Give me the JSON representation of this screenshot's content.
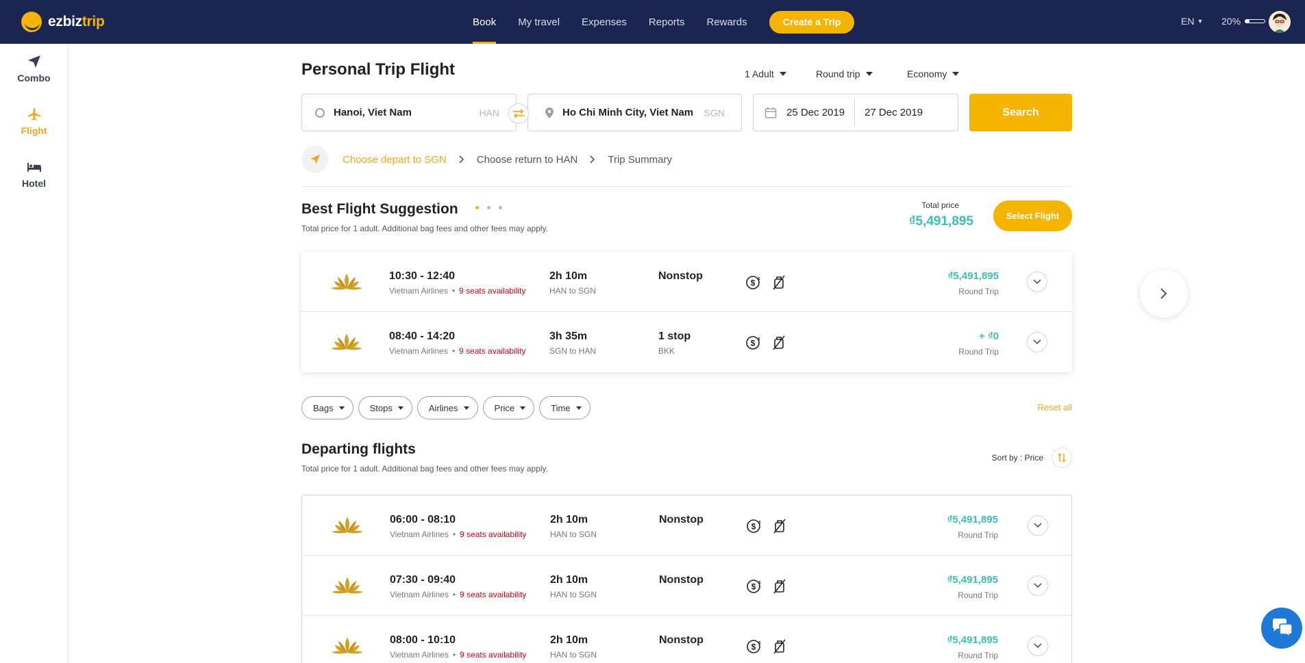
{
  "brand": {
    "name_part1": "ezbiz",
    "name_part2": "trip"
  },
  "nav": {
    "items": [
      "Book",
      "My travel",
      "Expenses",
      "Reports",
      "Rewards"
    ],
    "create_label": "Create a Trip",
    "language": "EN",
    "progress_label": "20%",
    "progress_value": 0.2
  },
  "sidebar": {
    "items": [
      "Combo",
      "Flight",
      "Hotel"
    ]
  },
  "page": {
    "title": "Personal Trip Flight"
  },
  "selectors": {
    "passengers": "1 Adult",
    "trip_type": "Round trip",
    "cabin": "Economy"
  },
  "search": {
    "from": "Hanoi, Viet Nam",
    "from_code": "HAN",
    "to": "Ho Chi Minh City, Viet Nam",
    "to_code": "SGN",
    "depart_date": "25 Dec 2019",
    "return_date": "27 Dec 2019",
    "button": "Search"
  },
  "steps": [
    "Choose depart to SGN",
    "Choose return to HAN",
    "Trip Summary"
  ],
  "best": {
    "title": "Best Flight Suggestion",
    "subtitle": "Total price for 1 adult. Additional bag fees and other fees may apply.",
    "total_label": "Total price",
    "total_price": "₫5,491,895",
    "select_button": "Select Flight",
    "rows": [
      {
        "time": "10:30 - 12:40",
        "airline": "Vietnam Airlines",
        "seats": "9 seats availability",
        "duration": "2h 10m",
        "route": "HAN to SGN",
        "stops": "Nonstop",
        "via": "",
        "price": "₫5,491,895",
        "price_type": "Round Trip"
      },
      {
        "time": "08:40 - 14:20",
        "airline": "Vietnam Airlines",
        "seats": "9 seats availability",
        "duration": "3h 35m",
        "route": "SGN to HAN",
        "stops": "1 stop",
        "via": "BKK",
        "price": "+ ₫0",
        "price_type": "Round Trip"
      }
    ]
  },
  "filters": {
    "items": [
      "Bags",
      "Stops",
      "Airlines",
      "Price",
      "Time"
    ],
    "reset": "Reset all"
  },
  "departing": {
    "title": "Departing flights",
    "subtitle": "Total price for 1 adult. Additional bag fees and other fees may apply.",
    "sort_label": "Sort by : Price",
    "rows": [
      {
        "time": "06:00 - 08:10",
        "airline": "Vietnam Airlines",
        "seats": "9 seats availability",
        "duration": "2h 10m",
        "route": "HAN to SGN",
        "stops": "Nonstop",
        "price": "₫5,491,895",
        "price_type": "Round Trip"
      },
      {
        "time": "07:30 - 09:40",
        "airline": "Vietnam Airlines",
        "seats": "9 seats availability",
        "duration": "2h 10m",
        "route": "HAN to SGN",
        "stops": "Nonstop",
        "price": "₫5,491,895",
        "price_type": "Round Trip"
      },
      {
        "time": "08:00 - 10:10",
        "airline": "Vietnam Airlines",
        "seats": "9 seats availability",
        "duration": "2h 10m",
        "route": "HAN to SGN",
        "stops": "Nonstop",
        "price": "₫5,491,895",
        "price_type": "Round Trip"
      }
    ]
  },
  "colors": {
    "navy": "#1b2551",
    "accent": "#f5b400",
    "price": "#3cbfb0",
    "seats": "#d0021b"
  }
}
